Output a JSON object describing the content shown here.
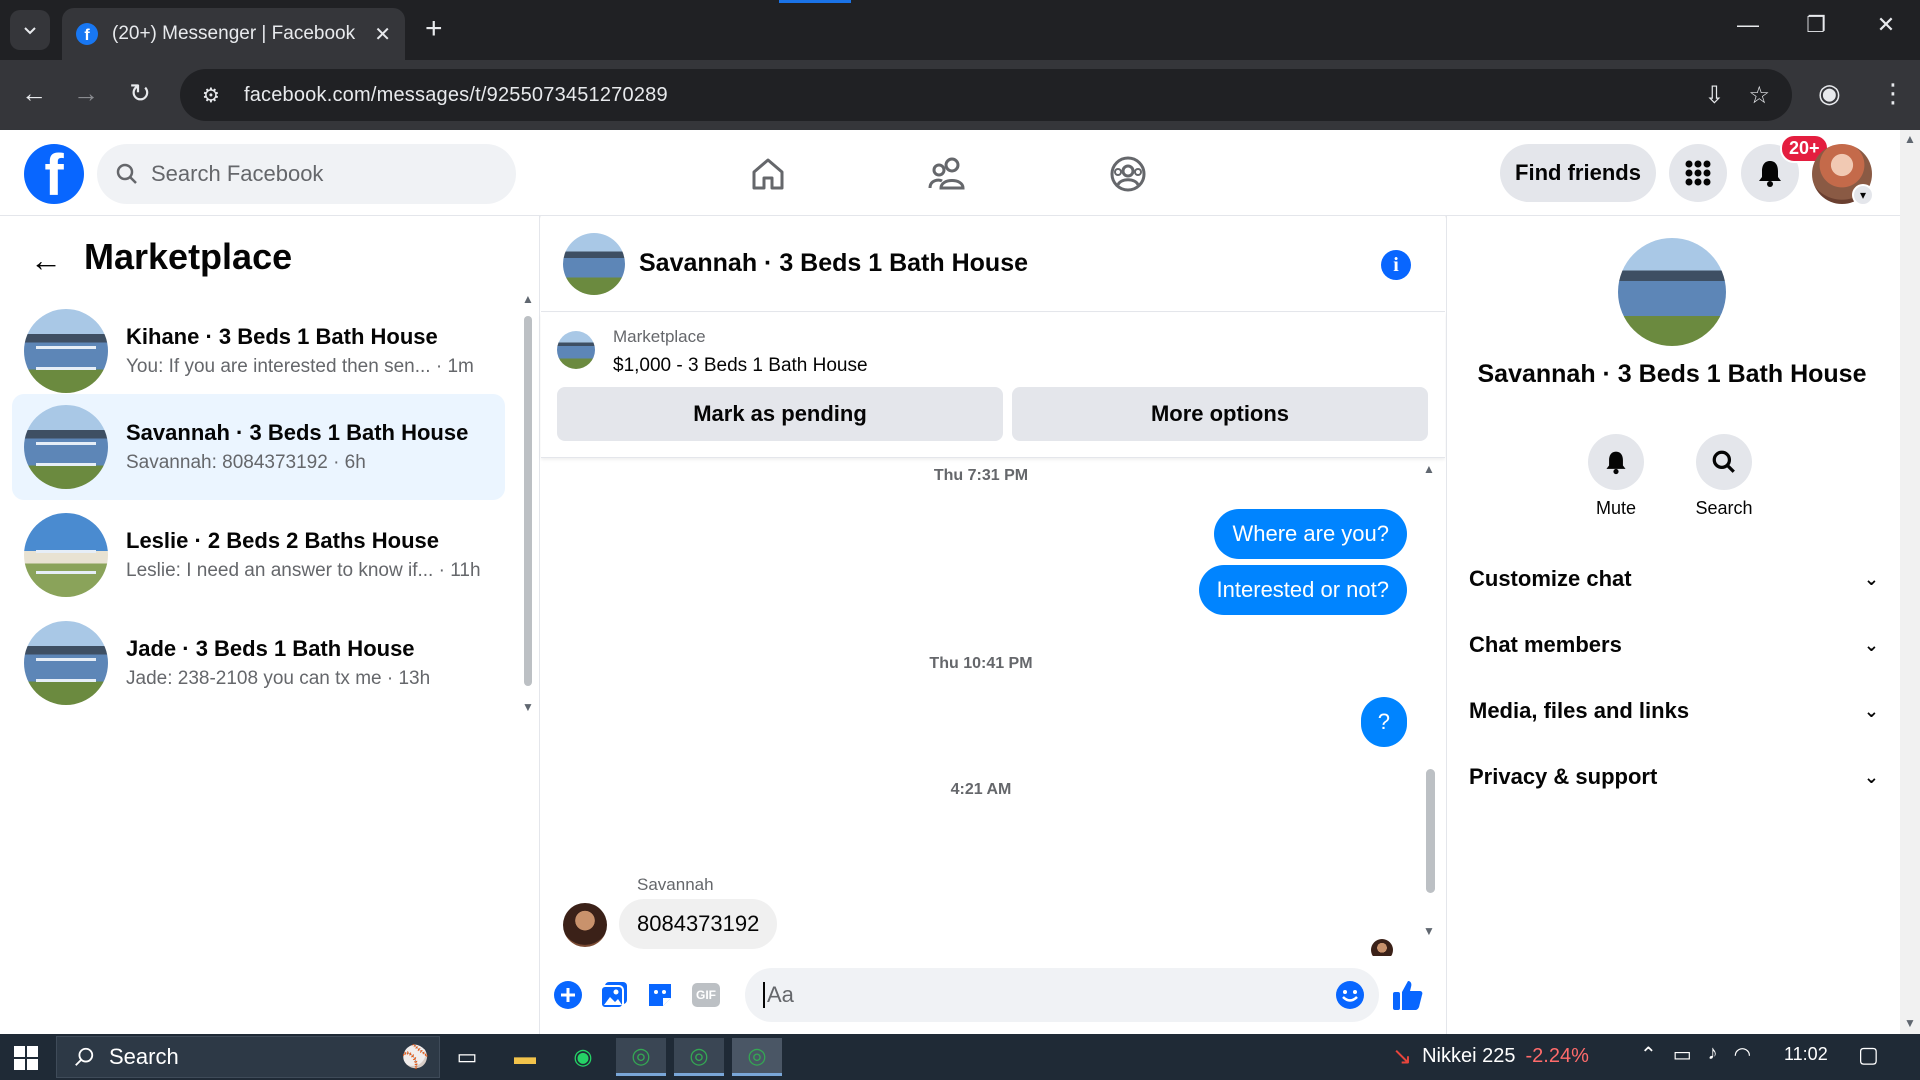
{
  "browser": {
    "tab_title": "(20+) Messenger | Facebook",
    "tab_favicon": "f",
    "new_tab": "+",
    "url": "facebook.com/messages/t/9255073451270289"
  },
  "fb_header": {
    "logo_letter": "f",
    "search_placeholder": "Search Facebook",
    "find_friends": "Find friends",
    "notification_badge": "20+"
  },
  "left_pane": {
    "title": "Marketplace",
    "conversations": [
      {
        "title": "Kihane · 3 Beds 1 Bath House",
        "snippet": "You: If you are interested then sen... · 1m",
        "active": false
      },
      {
        "title": "Savannah · 3 Beds 1 Bath House",
        "snippet": "Savannah: 8084373192 · 6h",
        "active": true
      },
      {
        "title": "Leslie · 2 Beds 2 Baths House",
        "snippet": "Leslie: I need an answer to know if... · 11h",
        "active": false
      },
      {
        "title": "Jade · 3 Beds 1 Bath House",
        "snippet": "Jade: 238-2108 you can tx me · 13h",
        "active": false
      }
    ]
  },
  "chat": {
    "title": "Savannah · 3 Beds 1 Bath House",
    "listing": {
      "label": "Marketplace",
      "price_title": "$1,000 - 3 Beds 1 Bath House",
      "mark_pending": "Mark as pending",
      "more_options": "More options"
    },
    "messages": {
      "ts1": "Thu 7:31 PM",
      "out1": "Where are you?",
      "out2": "Interested or not?",
      "ts2": "Thu 10:41 PM",
      "out3": "?",
      "ts3": "4:21 AM",
      "sender": "Savannah",
      "in1": "8084373192"
    },
    "composer_placeholder": "Aa",
    "gif_label": "GIF"
  },
  "right_pane": {
    "title": "Savannah · 3 Beds 1 Bath House",
    "mute": "Mute",
    "search": "Search",
    "rows": [
      "Customize chat",
      "Chat members",
      "Media, files and links",
      "Privacy & support"
    ]
  },
  "taskbar": {
    "search_placeholder": "Search",
    "nikkei_label": "Nikkei 225",
    "nikkei_change": "-2.24%",
    "clock": "11:02"
  },
  "colors": {
    "fb_blue": "#0866ff",
    "messenger_blue": "#0084ff",
    "active_row": "#ebf5ff",
    "badge_red": "#e41e3f"
  }
}
